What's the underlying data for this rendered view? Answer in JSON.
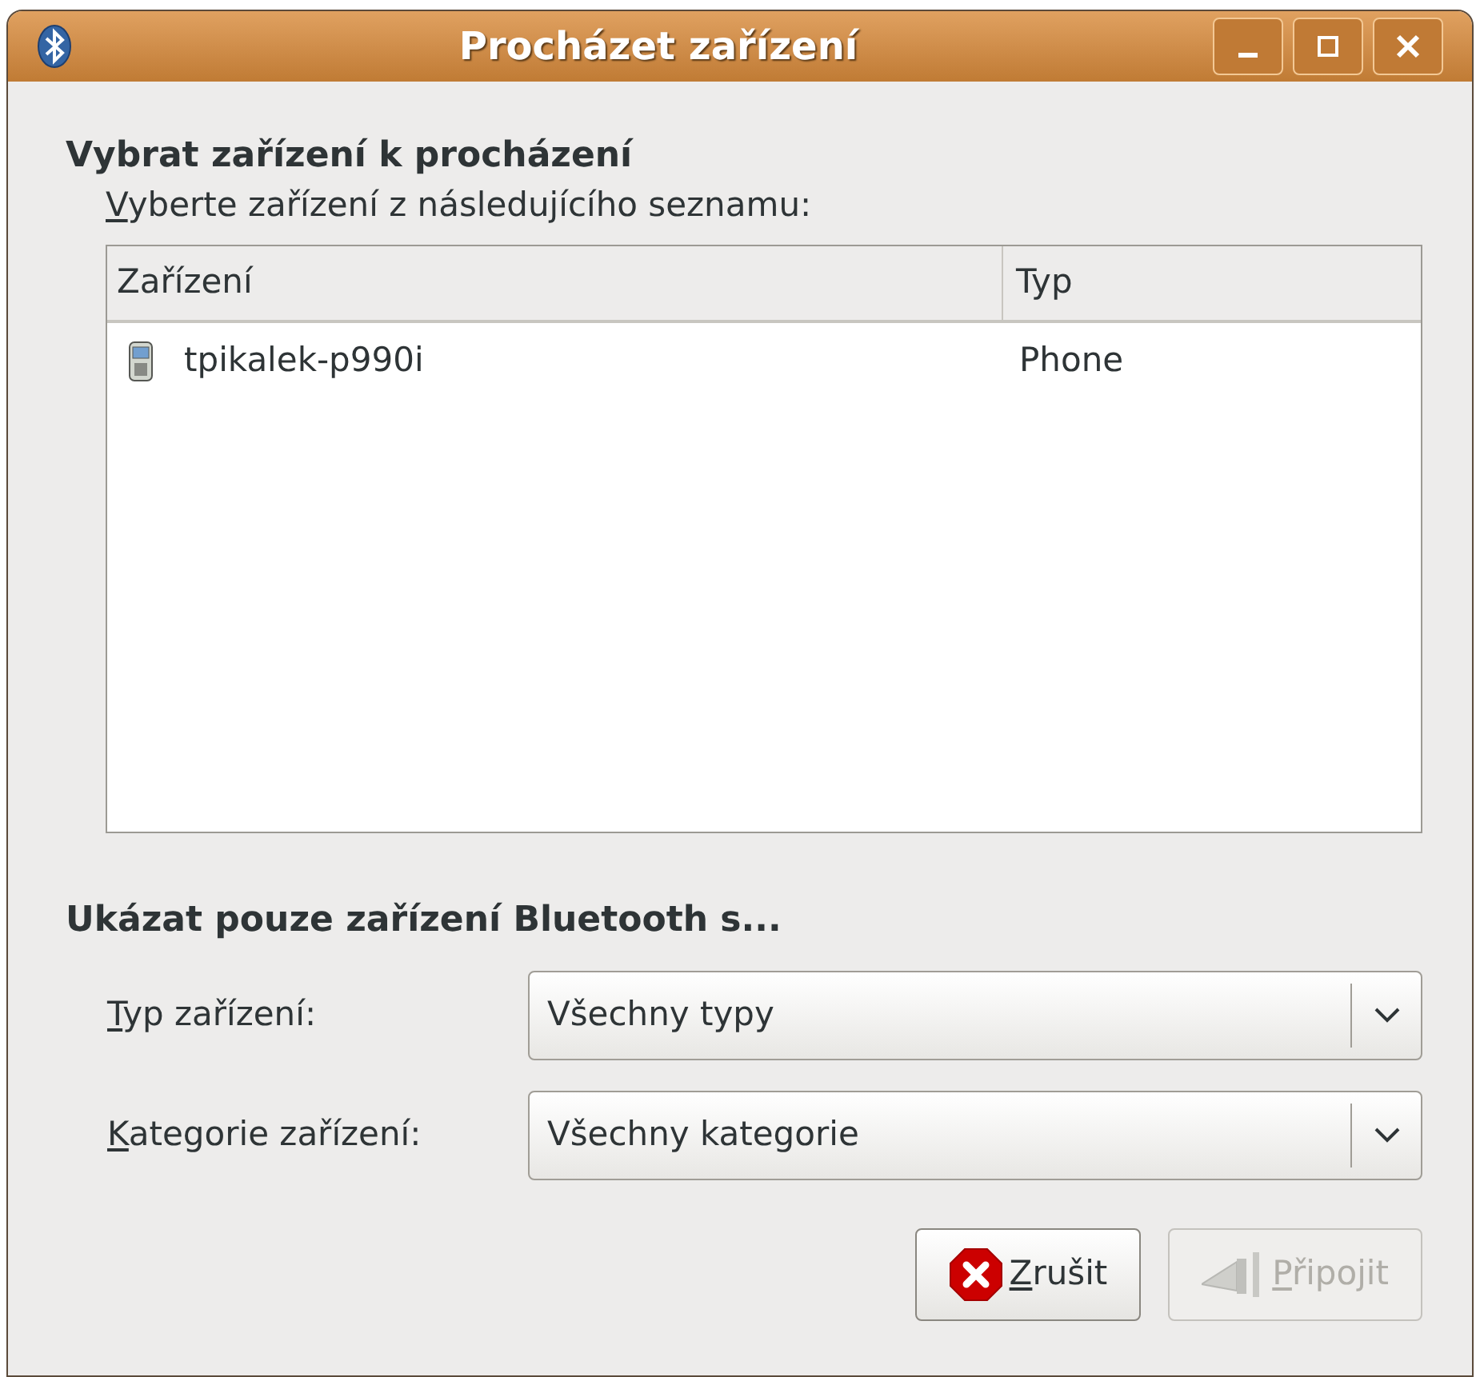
{
  "window": {
    "title": "Procházet zařízení"
  },
  "section_select": {
    "heading": "Vybrat zařízení k procházení",
    "instruction": "Vyberte zařízení z následujícího seznamu:",
    "mnemonic": true
  },
  "table": {
    "columns": [
      "Zařízení",
      "Typ"
    ],
    "rows": [
      {
        "name": "tpikalek-p990i",
        "type": "Phone",
        "selected": false
      }
    ]
  },
  "section_filter": {
    "heading": "Ukázat pouze zařízení Bluetooth s..."
  },
  "filters": [
    {
      "label": "Typ zařízení:",
      "value": "Všechny typy",
      "mnemonic": true
    },
    {
      "label": "Kategorie zařízení:",
      "value": "Všechny kategorie",
      "mnemonic": true
    }
  ],
  "buttons": [
    {
      "kind": "cancel",
      "label": "Zrušit",
      "disabled": false,
      "mnemonic": true
    },
    {
      "kind": "connect",
      "label": "Připojit",
      "disabled": true,
      "mnemonic": true
    }
  ]
}
